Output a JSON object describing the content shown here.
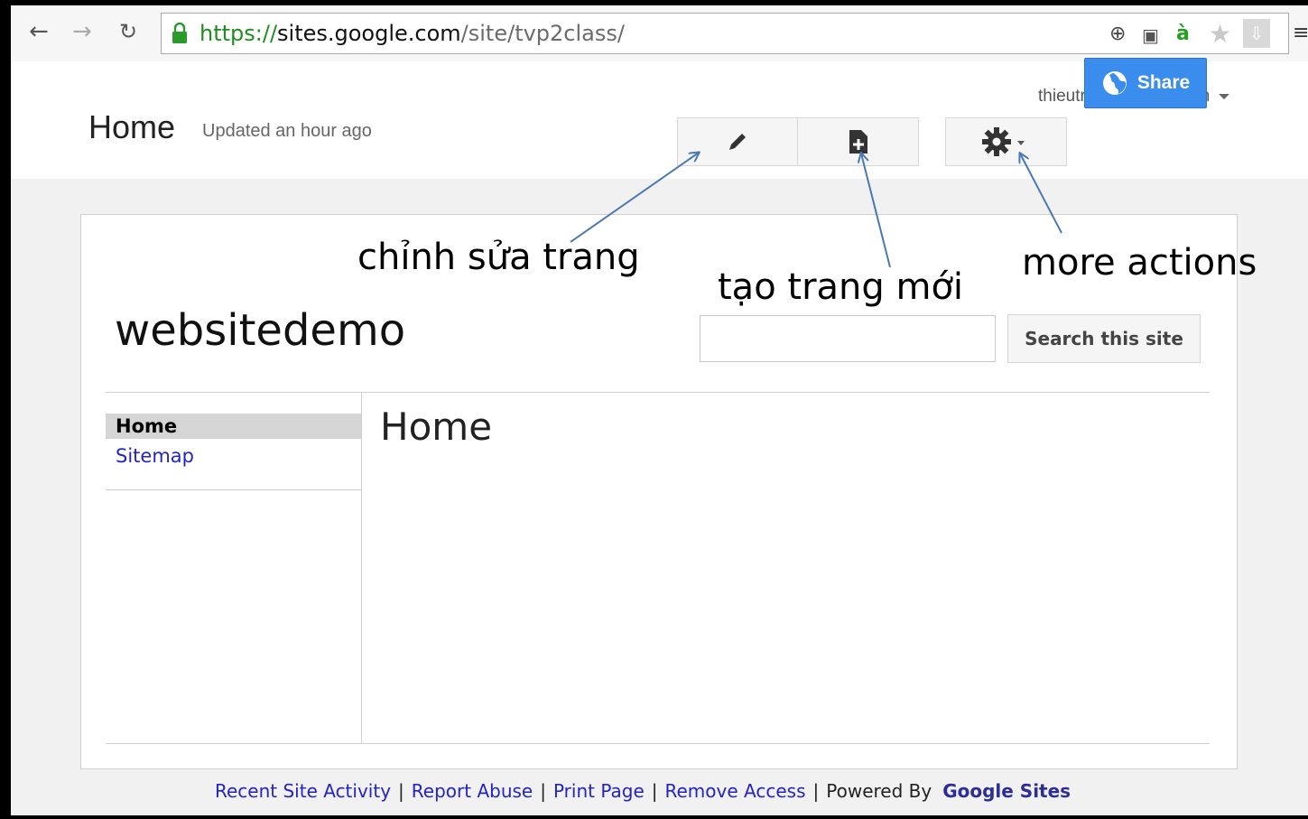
{
  "browser": {
    "back_icon": "arrow-left-icon",
    "forward_icon": "arrow-right-icon",
    "reload_icon": "reload-icon",
    "url_scheme": "https://",
    "url_host": "sites.google.com",
    "url_path": "/site/tvp2class/"
  },
  "header": {
    "page_title": "Home",
    "updated": "Updated an hour ago",
    "account": "thieutrung@gmail.com",
    "share_label": "Share"
  },
  "site": {
    "name": "websitedemo",
    "search_placeholder": "",
    "search_button": "Search this site"
  },
  "sidebar": {
    "items": [
      {
        "label": "Home"
      },
      {
        "label": "Sitemap"
      }
    ]
  },
  "content": {
    "title": "Home"
  },
  "footer": {
    "links": [
      "Recent Site Activity",
      "Report Abuse",
      "Print Page",
      "Remove Access"
    ],
    "powered_by": "Powered By",
    "brand": "Google Sites"
  },
  "annotations": {
    "edit": "chỉnh sửa trang",
    "new_page": "tạo trang mới",
    "more_actions": "more actions"
  },
  "colors": {
    "share_blue": "#3b8ded",
    "link_blue": "#2323c8",
    "arrow_blue": "#4a78b5"
  }
}
